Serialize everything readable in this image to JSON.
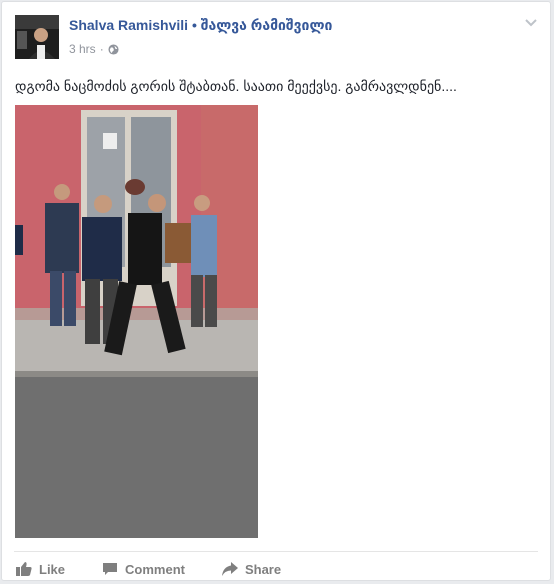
{
  "post": {
    "author": "Shalva Ramishvili • შალვა რამიშვილი",
    "time": "3 hrs",
    "separator": "·",
    "text": "დგომა ნაცმოძის გორის შტაბთან. საათი მეექვსე. გამრავლდნენ....",
    "photo_description": "Group of men standing on a sidewalk in front of a pink building entrance"
  },
  "actions": {
    "like_label": "Like",
    "comment_label": "Comment",
    "share_label": "Share"
  },
  "colors": {
    "author": "#365899",
    "text": "#1d2129",
    "meta": "#90949c",
    "action": "#7f7f7f"
  },
  "icons": [
    "globe-icon",
    "chevron-down-icon",
    "like-icon",
    "comment-icon",
    "share-icon"
  ]
}
